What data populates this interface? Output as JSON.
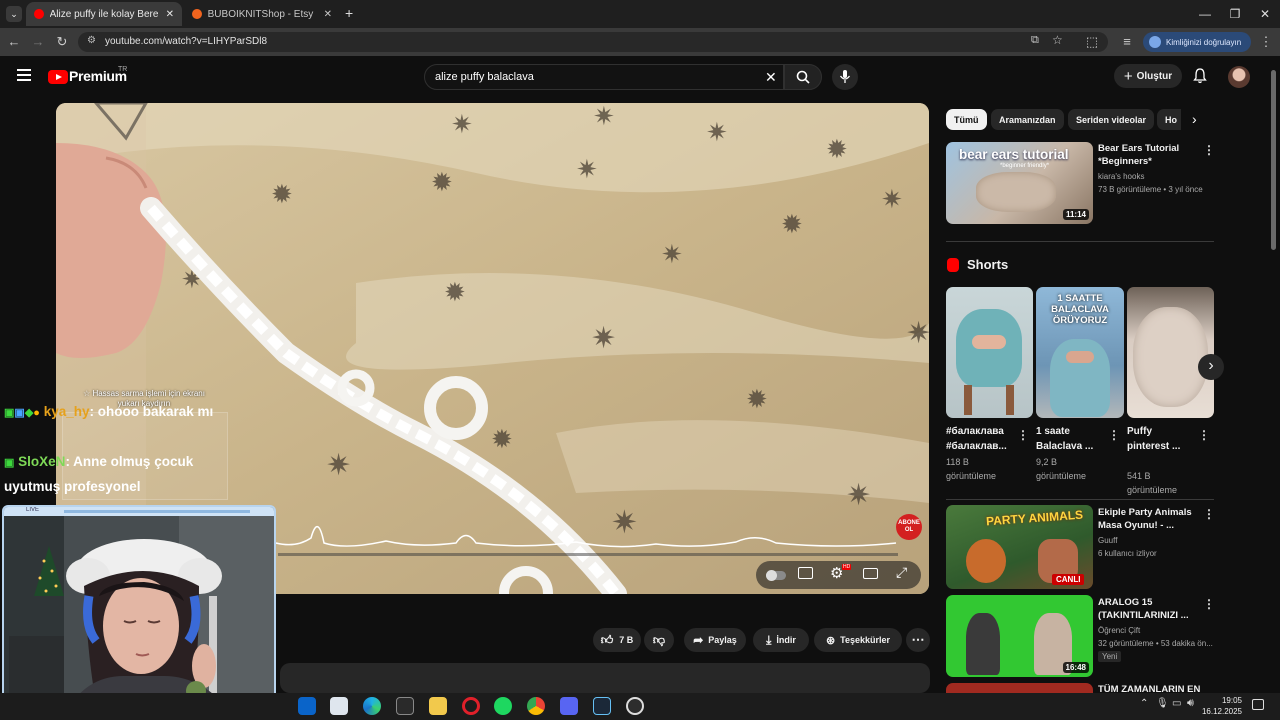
{
  "browser": {
    "tabs": [
      {
        "title": "Alize puffy ile kolay Bere yapımı",
        "active": true,
        "favicon_color": "#ff0000"
      },
      {
        "title": "BUBOIKNITShop - Etsy",
        "active": false,
        "favicon_color": "#f1641e"
      }
    ],
    "url": "youtube.com/watch?v=LIHYParSDl8",
    "signin_label": "Kimliğinizi doğrulayın"
  },
  "youtube": {
    "logo_text": "Premium",
    "country_code": "TR",
    "search_value": "alize puffy balaclava",
    "create_label": "Oluştur"
  },
  "video": {
    "caption_text": "☆ Hassas sarma işlemi için ekranı yukarı kaydırın",
    "subscribe_badge": "ABONE OL",
    "actions": {
      "like_count": "7 B",
      "share_label": "Paylaş",
      "download_label": "İndir",
      "thanks_label": "Teşekkürler"
    }
  },
  "sidebar": {
    "chips": [
      "Tümü",
      "Aramanızdan",
      "Seriden videolar",
      "Ho"
    ],
    "recommendations": [
      {
        "title": "Bear Ears Tutorial *Beginners*",
        "channel": "kiara's hooks",
        "meta": "73 B görüntüleme • 3 yıl önce",
        "duration": "11:14",
        "thumb_text": "bear ears tutorial",
        "thumb_sub": "*beginner friendly*"
      }
    ],
    "shorts_title": "Shorts",
    "shorts": [
      {
        "title": "#балаклава #балаклав...",
        "views": "118 B görüntüleme"
      },
      {
        "title": "1 saate Balaclava ...",
        "views": "9,2 B görüntüleme",
        "thumb_text": "1 SAATTE BALACLAVA ÖRÜYORUZ"
      },
      {
        "title": "Puffy pinterest ...",
        "views": "541 B görüntüleme"
      }
    ],
    "recs2": [
      {
        "title": "Ekiple Party Animals Masa Oyunu! - ...",
        "channel": "Guuff",
        "meta": "6 kullanıcı izliyor",
        "badge": "CANLI",
        "thumb_text": "PARTY ANIMALS"
      },
      {
        "title": "ARALOG 15 (TAKINTILARINIZI ...",
        "channel": "Öğrenci Çift",
        "meta": "32 görüntüleme • 53 dakika ön...",
        "badge": "Yeni",
        "duration": "16:48"
      },
      {
        "title": "TÜM ZAMANLARIN EN"
      }
    ]
  },
  "stream_overlay": {
    "chat": [
      {
        "user": "kya_hy",
        "message": ": ohooo bakarak mı",
        "user_color": "#e6a11b"
      },
      {
        "user": "SloXeN",
        "message": ": Anne olmuş çocuk uyutmuş profesyonel",
        "user_color": "#7ed957"
      }
    ],
    "webcam_label": "LIVE"
  },
  "taskbar": {
    "time": "19:05",
    "date": "16.12.2025"
  },
  "colors": {
    "accent_red": "#ff0000",
    "chip_active": "#f1f1f1",
    "chip_bg": "#272727",
    "signin_bg": "#2b4a78"
  }
}
